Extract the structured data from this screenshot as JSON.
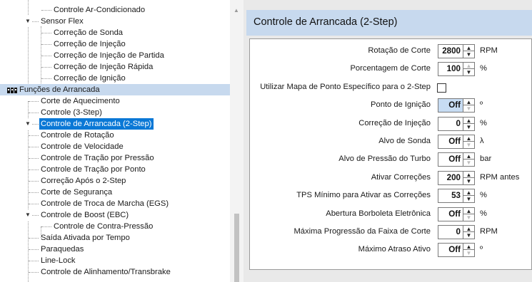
{
  "tree": {
    "items": [
      {
        "label": "Controle Ar-Condicionado",
        "level": 2
      },
      {
        "label": "Sensor Flex",
        "level": 1,
        "expanded": true
      },
      {
        "label": "Correção de Sonda",
        "level": 2
      },
      {
        "label": "Correção de Injeção",
        "level": 2
      },
      {
        "label": "Correção de Injeção de Partida",
        "level": 2
      },
      {
        "label": "Correção de Injeção Rápida",
        "level": 2
      },
      {
        "label": "Correção de Ignição",
        "level": 2
      },
      {
        "label": "Funções de Arrancada",
        "level": 0,
        "group": true
      },
      {
        "label": "Corte de Aquecimento",
        "level": 1
      },
      {
        "label": "Controle (3-Step)",
        "level": 1
      },
      {
        "label": "Controle de Arrancada (2-Step)",
        "level": 1,
        "selected": true
      },
      {
        "label": "Controle de Rotação",
        "level": 1
      },
      {
        "label": "Controle de Velocidade",
        "level": 1
      },
      {
        "label": "Controle de Tração por Pressão",
        "level": 1
      },
      {
        "label": "Controle de Tração por Ponto",
        "level": 1
      },
      {
        "label": "Correção Após o 2-Step",
        "level": 1
      },
      {
        "label": "Corte de Segurança",
        "level": 1
      },
      {
        "label": "Controle de Troca de Marcha (EGS)",
        "level": 1
      },
      {
        "label": "Controle de Boost (EBC)",
        "level": 1,
        "expanded": true
      },
      {
        "label": "Controle de Contra-Pressão",
        "level": 2
      },
      {
        "label": "Saída Ativada por Tempo",
        "level": 1
      },
      {
        "label": "Paraquedas",
        "level": 1
      },
      {
        "label": "Line-Lock",
        "level": 1
      },
      {
        "label": "Controle de Alinhamento/Transbrake",
        "level": 1
      }
    ]
  },
  "panel": {
    "title": "Controle de Arrancada (2-Step)",
    "rows": [
      {
        "label": "Rotação de Corte",
        "value": "2800",
        "unit": "RPM",
        "type": "spin"
      },
      {
        "label": "Porcentagem de Corte",
        "value": "100",
        "unit": "%",
        "type": "spin",
        "up_disabled": true
      },
      {
        "label": "Utilizar Mapa de Ponto Específico para o 2-Step",
        "type": "check",
        "checked": false
      },
      {
        "label": "Ponto de Ignição",
        "value": "Off",
        "unit": "º",
        "type": "spin",
        "focused": true,
        "down_disabled": true
      },
      {
        "label": "Correção de Injeção",
        "value": "0",
        "unit": "%",
        "type": "spin"
      },
      {
        "label": "Alvo de Sonda",
        "value": "Off",
        "unit": "λ",
        "type": "spin",
        "down_disabled": true
      },
      {
        "label": "Alvo de Pressão do Turbo",
        "value": "Off",
        "unit": "bar",
        "type": "spin",
        "down_disabled": true
      },
      {
        "label": "Ativar Correções",
        "value": "200",
        "unit": "RPM antes",
        "type": "spin"
      },
      {
        "label": "TPS Mínimo para Ativar as Correções",
        "value": "53",
        "unit": "%",
        "type": "spin"
      },
      {
        "label": "Abertura Borboleta Eletrônica",
        "value": "Off",
        "unit": "%",
        "type": "spin",
        "down_disabled": true
      },
      {
        "label": "Máxima Progressão da Faixa de Corte",
        "value": "0",
        "unit": "RPM",
        "type": "spin"
      },
      {
        "label": "Máximo Atraso Ativo",
        "value": "Off",
        "unit": "º",
        "type": "spin",
        "down_disabled": true
      }
    ]
  },
  "icons": {
    "group": "pin-header-icon",
    "expand": "triangle-down-icon",
    "spin_up": "triangle-up-icon",
    "spin_down": "triangle-down-icon",
    "scroll_up": "chevron-up-icon"
  },
  "colors": {
    "selection": "#0a78d6",
    "header_bg": "#c7d9ee",
    "focus_bg": "#c7dcf3"
  }
}
